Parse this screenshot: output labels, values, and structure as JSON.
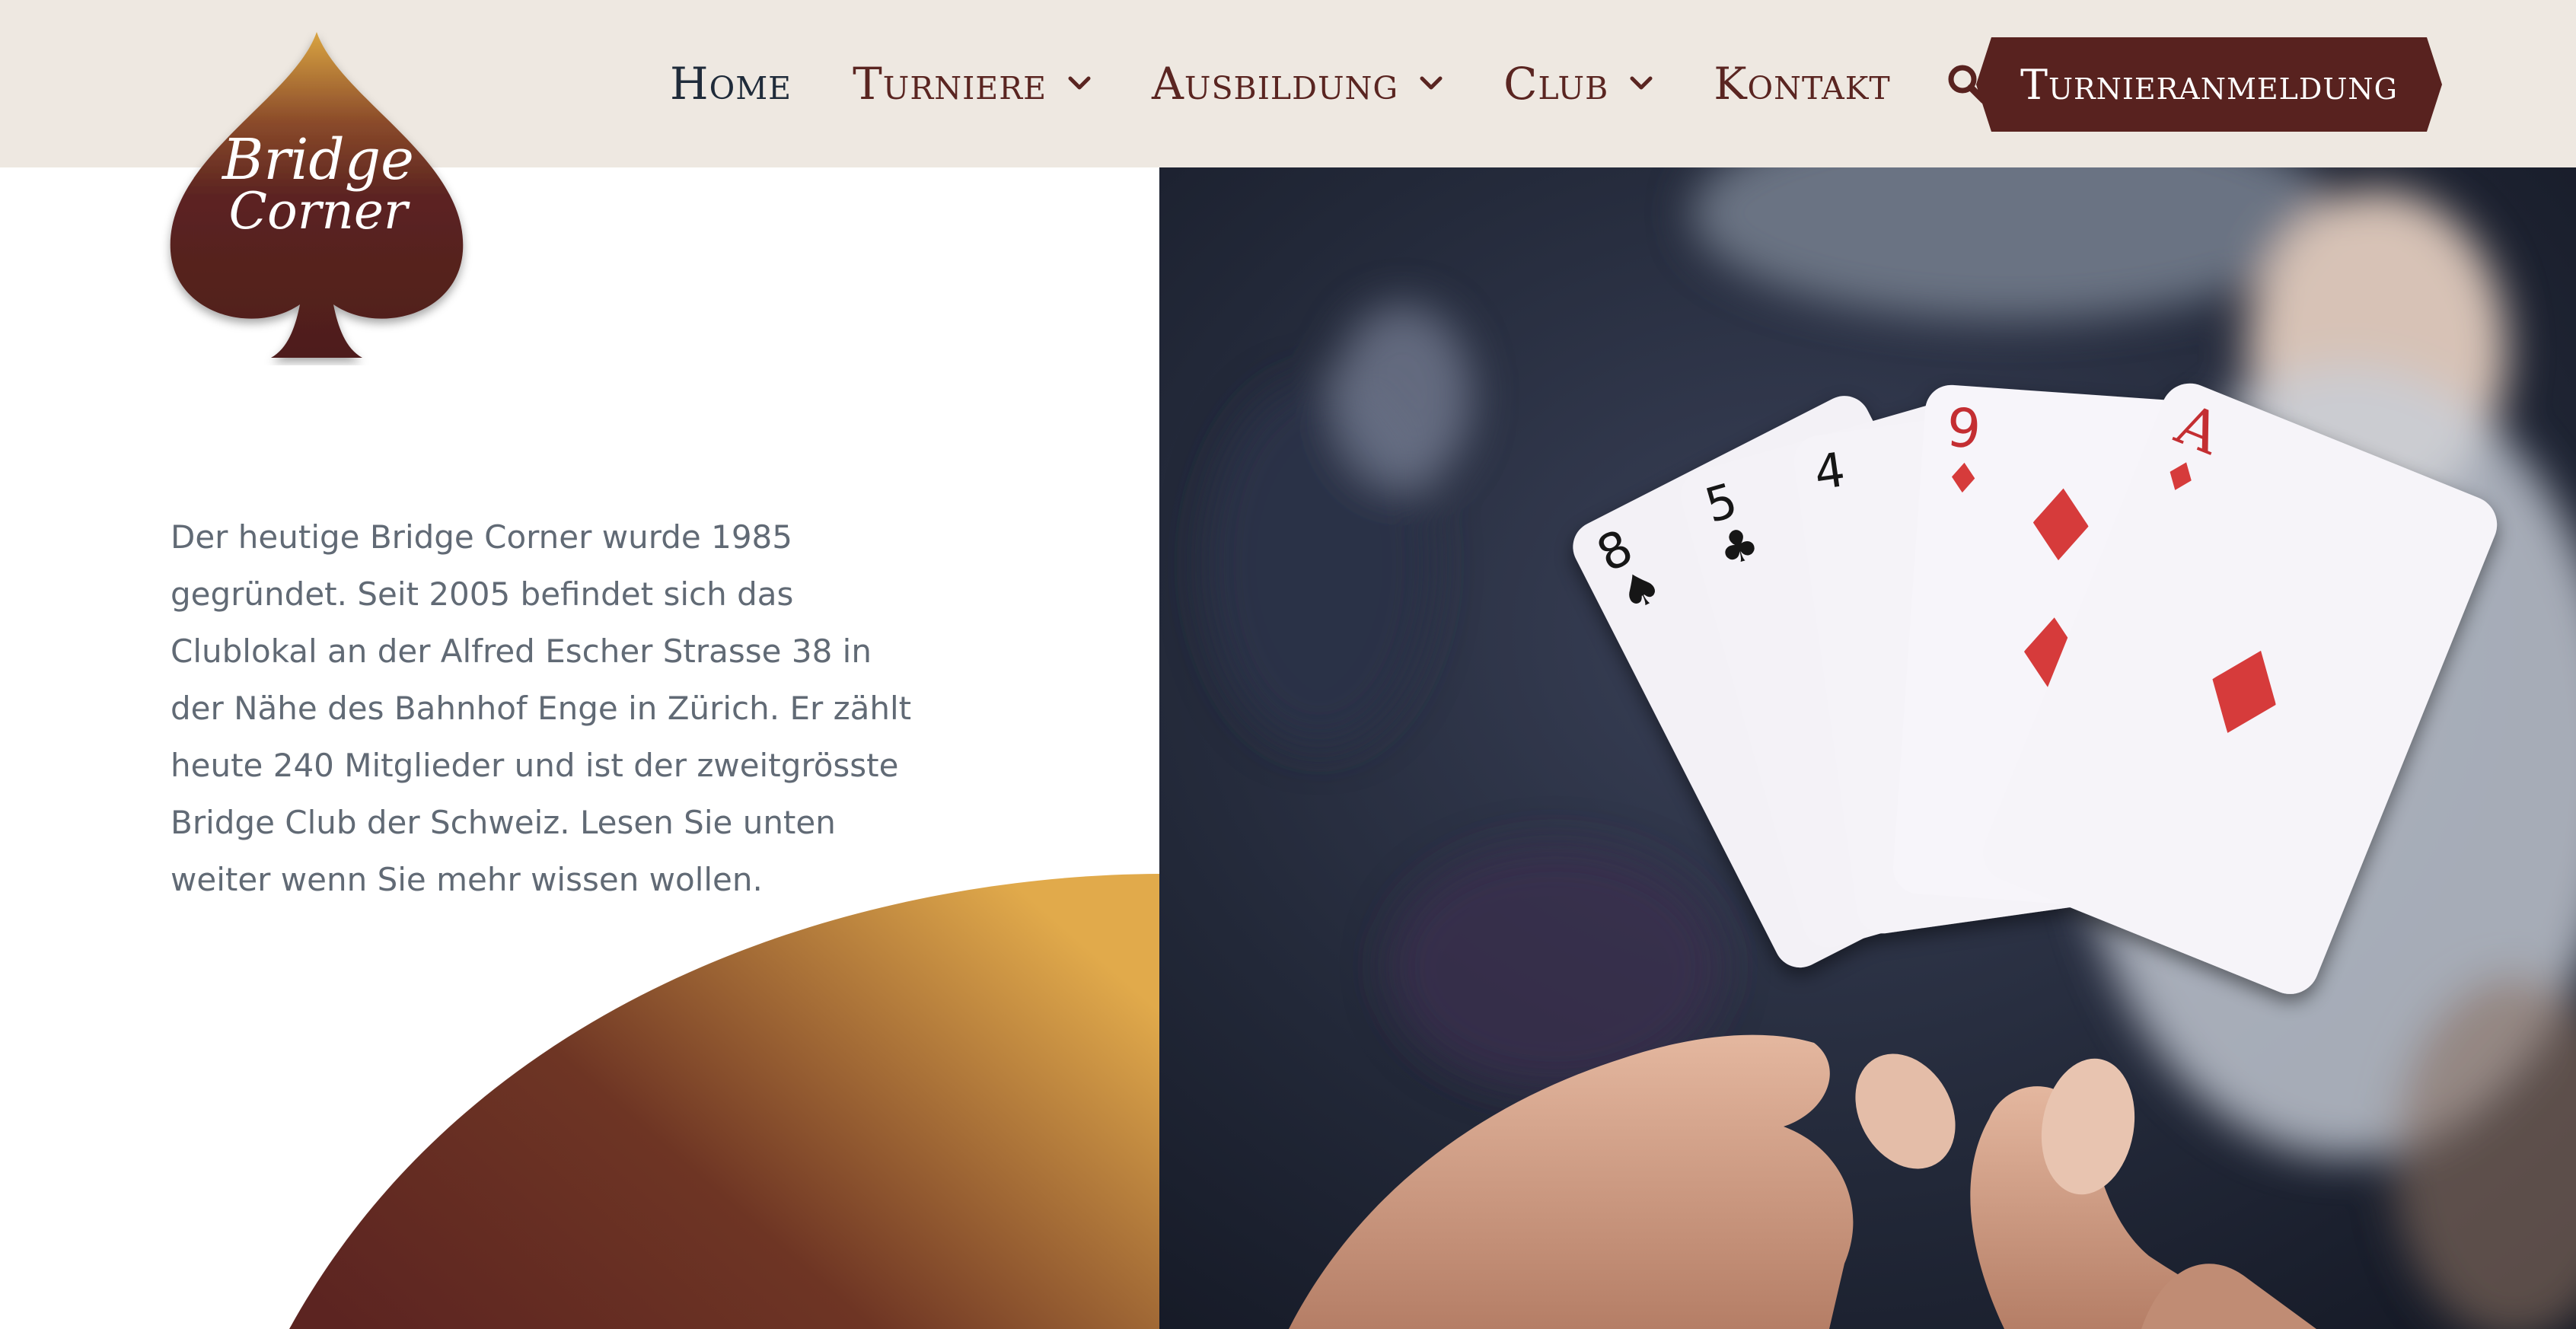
{
  "brand": {
    "logo_line1": "Bridge",
    "logo_line2": "Corner"
  },
  "nav": {
    "items": [
      {
        "label": "Home",
        "has_dropdown": false
      },
      {
        "label": "Turniere",
        "has_dropdown": true
      },
      {
        "label": "Ausbildung",
        "has_dropdown": true
      },
      {
        "label": "Club",
        "has_dropdown": true
      },
      {
        "label": "Kontakt",
        "has_dropdown": false
      }
    ],
    "search_icon": "search-icon",
    "cta_label": "Turnieranmeldung"
  },
  "intro": {
    "text": "Der heutige Bridge Corner wurde 1985 gegründet. Seit 2005 befindet sich das Clublokal an der Alfred Escher Strasse 38 in der Nähe des Bahnhof Enge in Zürich. Er zählt heute 240 Mitglieder und ist der zweitgrösste Bridge Club der Schweiz. Lesen Sie unten weiter wenn Sie mehr wissen wollen."
  },
  "colors": {
    "header_bg": "#eee8e1",
    "brand_maroon": "#58221f",
    "gold": "#d9a441",
    "nav_text": "#5a2521",
    "home_text": "#1f2b3a",
    "body_text": "#616a75",
    "card_red": "#d63a3a"
  }
}
